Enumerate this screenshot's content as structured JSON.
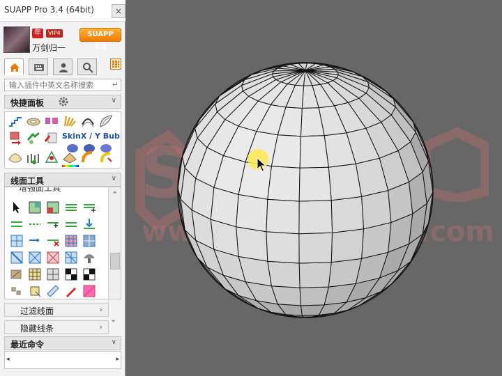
{
  "window": {
    "title": "SUAPP Pro 3.4 (64bit)",
    "close": "×"
  },
  "profile": {
    "year_badge": "年",
    "vip_badge": "VIP4",
    "brand_button": "SUAPP 3.4",
    "username": "万剑归一"
  },
  "search": {
    "placeholder": "输入插件中英文名称搜索",
    "enter_glyph": "↵"
  },
  "sections": {
    "quick": {
      "label": "快捷面板",
      "skin_text": "SkinX / Y Bub"
    },
    "line_face": {
      "label": "线面工具",
      "partial_item": "增强面工具"
    },
    "filter": {
      "label": "过滤线面"
    },
    "hidden": {
      "label": "隐藏线条"
    },
    "recent": {
      "label": "最近命令"
    }
  },
  "watermark": {
    "big": "SU",
    "url": "www",
    "suffix": ".com"
  },
  "colors": {
    "accent_orange": "#f07b00",
    "panel_bg": "#f3f3f3",
    "viewport_bg": "#676767",
    "cursor_highlight": "#ffe94d"
  }
}
